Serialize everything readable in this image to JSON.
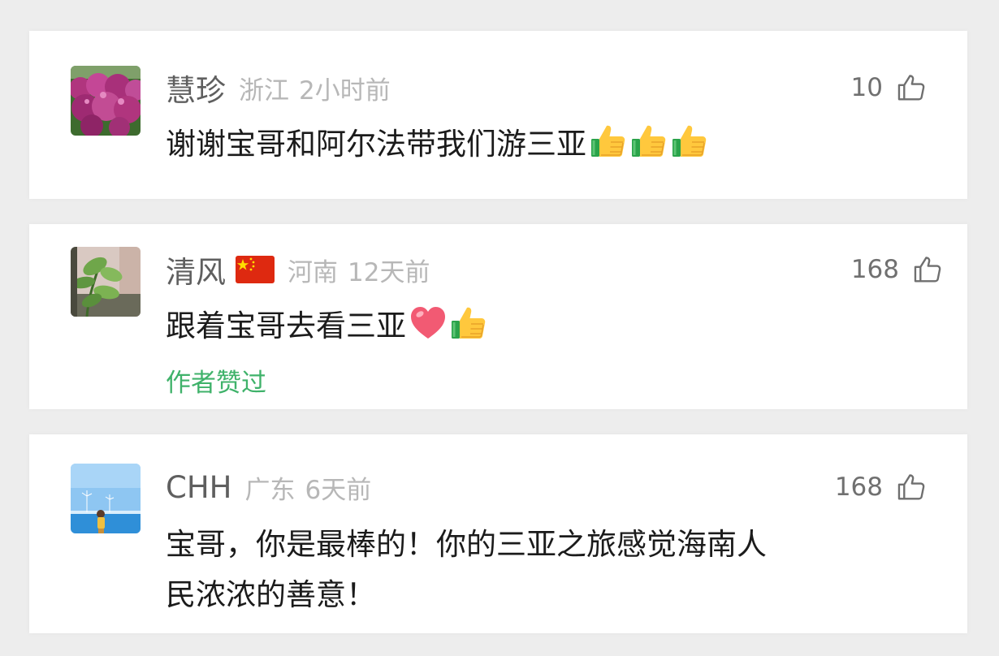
{
  "comments": [
    {
      "name": "慧珍",
      "location": "浙江",
      "time": "2小时前",
      "likes": "10",
      "text": "谢谢宝哥和阿尔法带我们游三亚",
      "emojis": [
        "thumbs-up-emoji",
        "thumbs-up-emoji",
        "thumbs-up-emoji"
      ],
      "avatar": "purple-flowers-avatar"
    },
    {
      "name": "清风",
      "flag": "china-flag-icon",
      "location": "河南",
      "time": "12天前",
      "likes": "168",
      "text": "跟着宝哥去看三亚",
      "emojis": [
        "heart-emoji",
        "thumbs-up-emoji"
      ],
      "author_liked": "作者赞过",
      "avatar": "green-plant-avatar"
    },
    {
      "name": "CHH",
      "location": "广东",
      "time": "6天前",
      "likes": "168",
      "text_line1": "宝哥，你是最棒的！你的三亚之旅感觉海南人",
      "text_line2": "民浓浓的善意！",
      "avatar": "beach-windmill-avatar"
    }
  ],
  "colors": {
    "background": "#ededed",
    "card": "#ffffff",
    "name": "#5f5f5f",
    "meta": "#b7b7b7",
    "text": "#1b1b1b",
    "author_liked": "#3fb26a"
  }
}
